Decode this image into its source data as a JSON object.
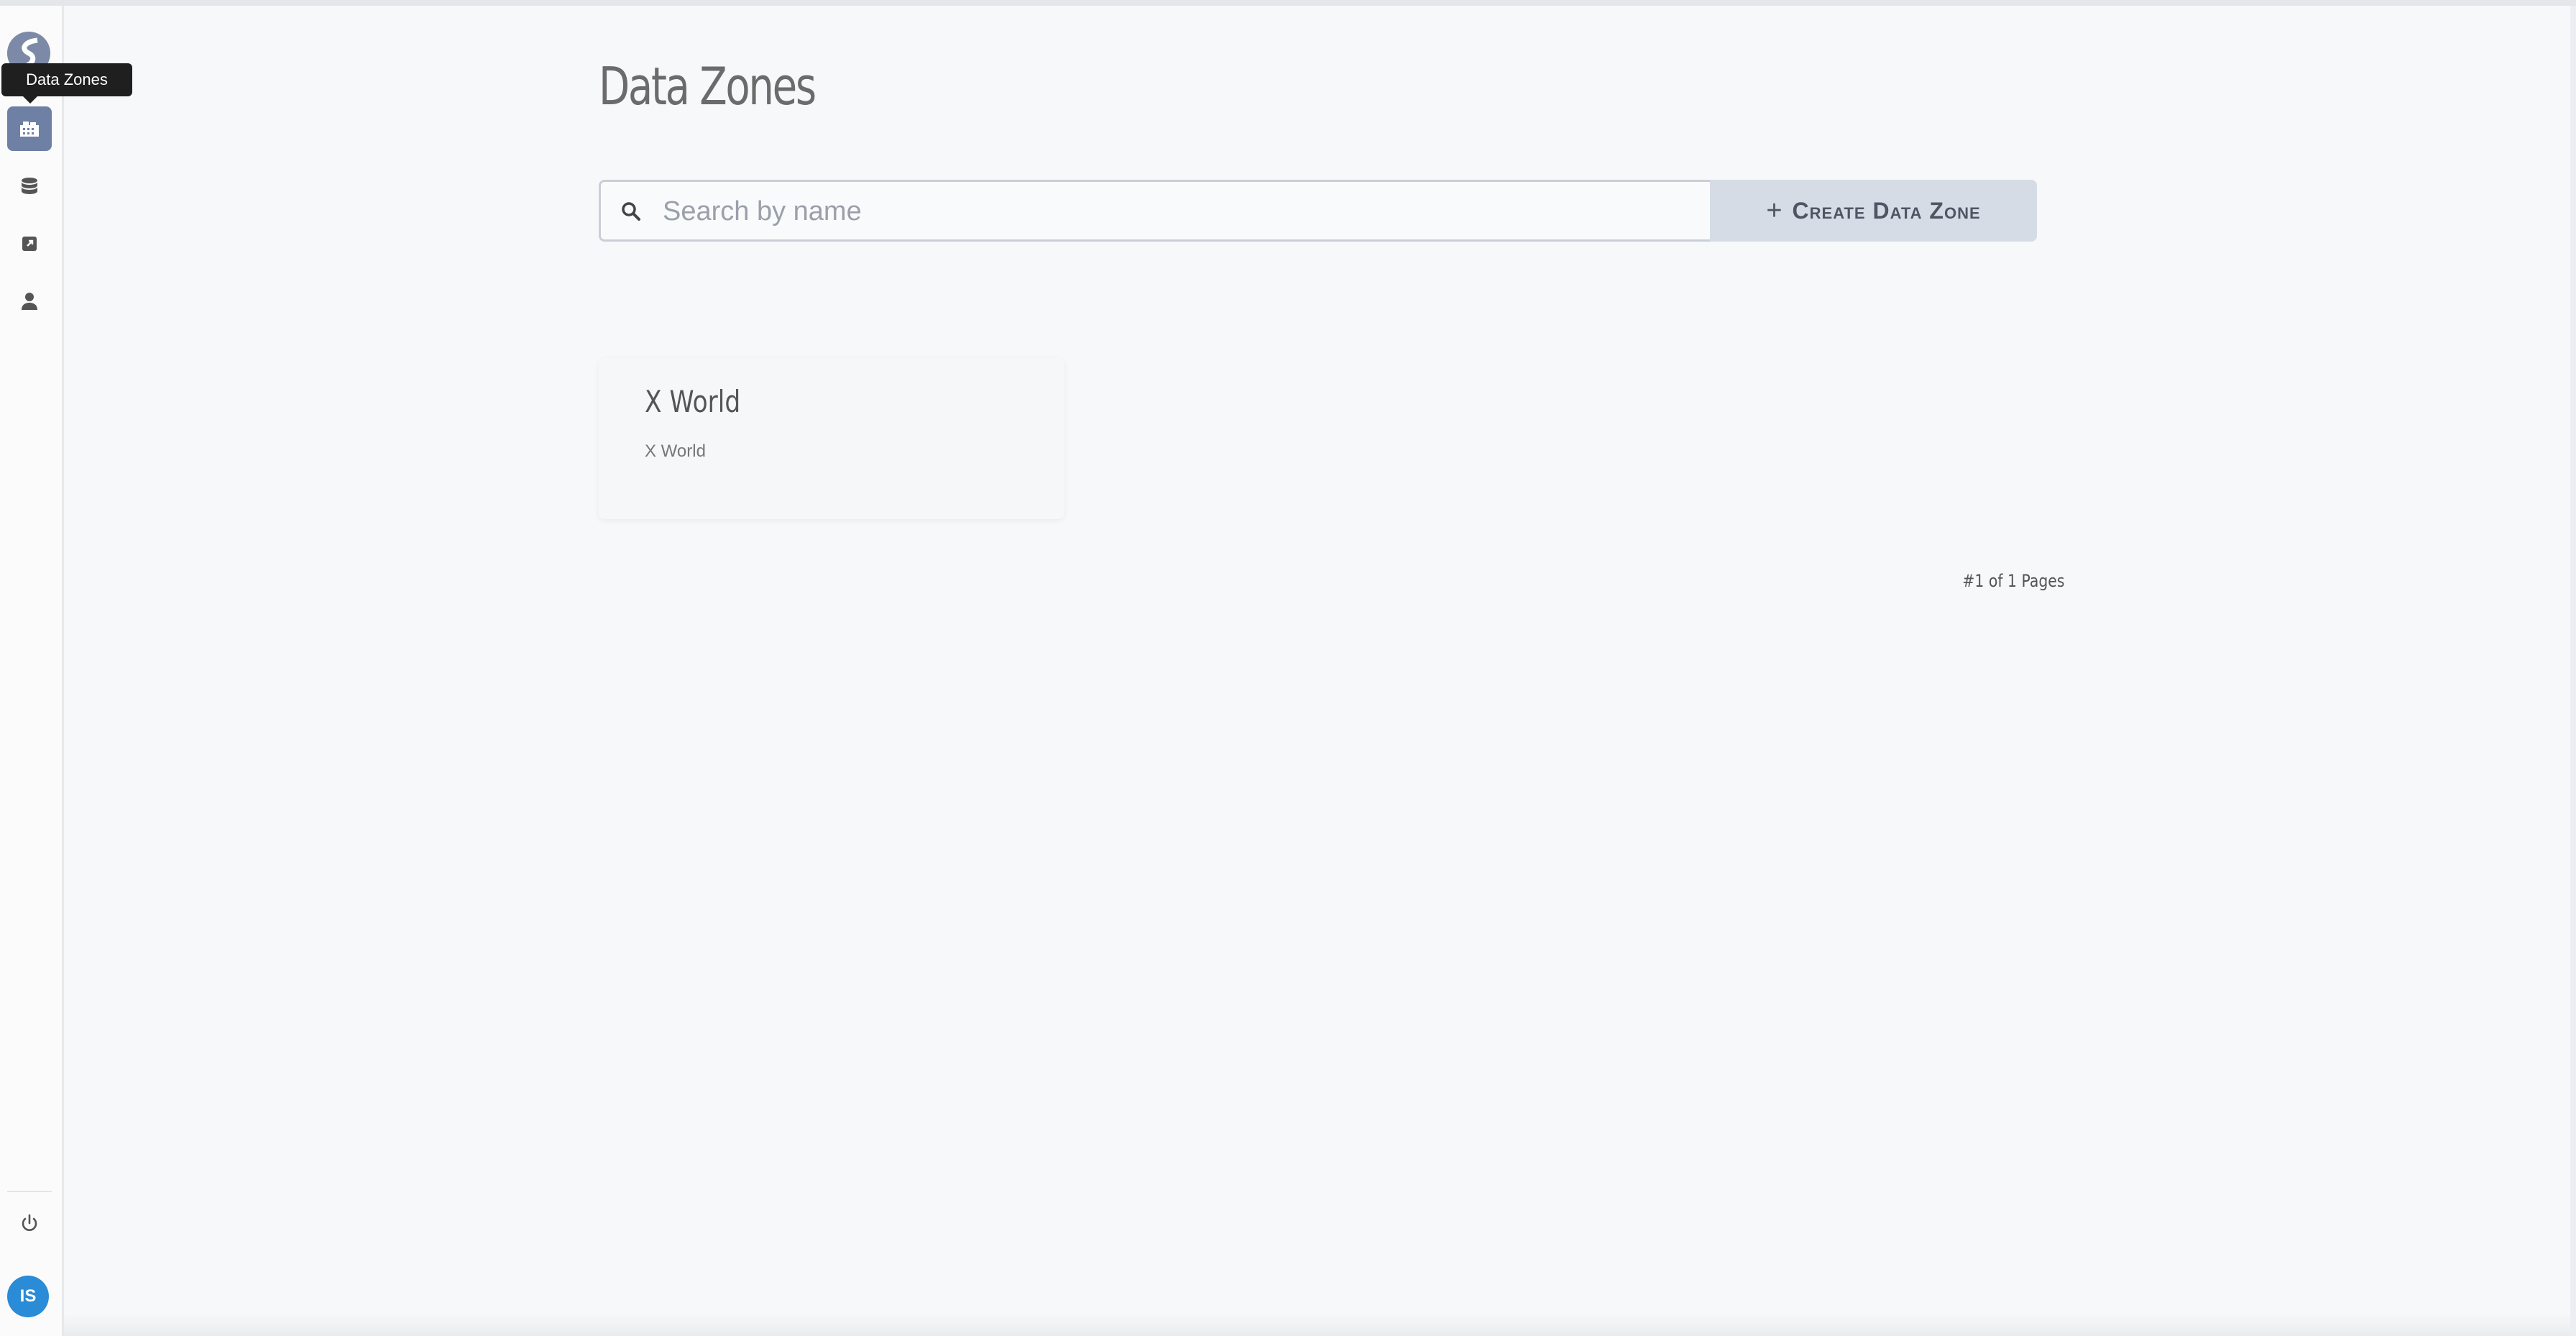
{
  "page": {
    "title": "Data Zones"
  },
  "sidebar": {
    "tooltip": "Data Zones",
    "items": [
      {
        "icon": "building-icon",
        "active": true
      },
      {
        "icon": "database-icon",
        "active": false
      },
      {
        "icon": "external-link-icon",
        "active": false
      },
      {
        "icon": "user-icon",
        "active": false
      }
    ],
    "bottom": {
      "power_icon": "power-icon",
      "avatar_initials": "IS"
    }
  },
  "search": {
    "placeholder": "Search by name",
    "value": ""
  },
  "toolbar": {
    "create_label": "Create Data Zone",
    "plus_symbol": "+"
  },
  "zones": [
    {
      "name": "X World",
      "description": "X World"
    }
  ],
  "pagination": {
    "text": "#1 of 1 Pages"
  },
  "colors": {
    "accent": "#6f80a5",
    "avatar": "#2a8bd6",
    "button_bg": "#d6dce5"
  }
}
